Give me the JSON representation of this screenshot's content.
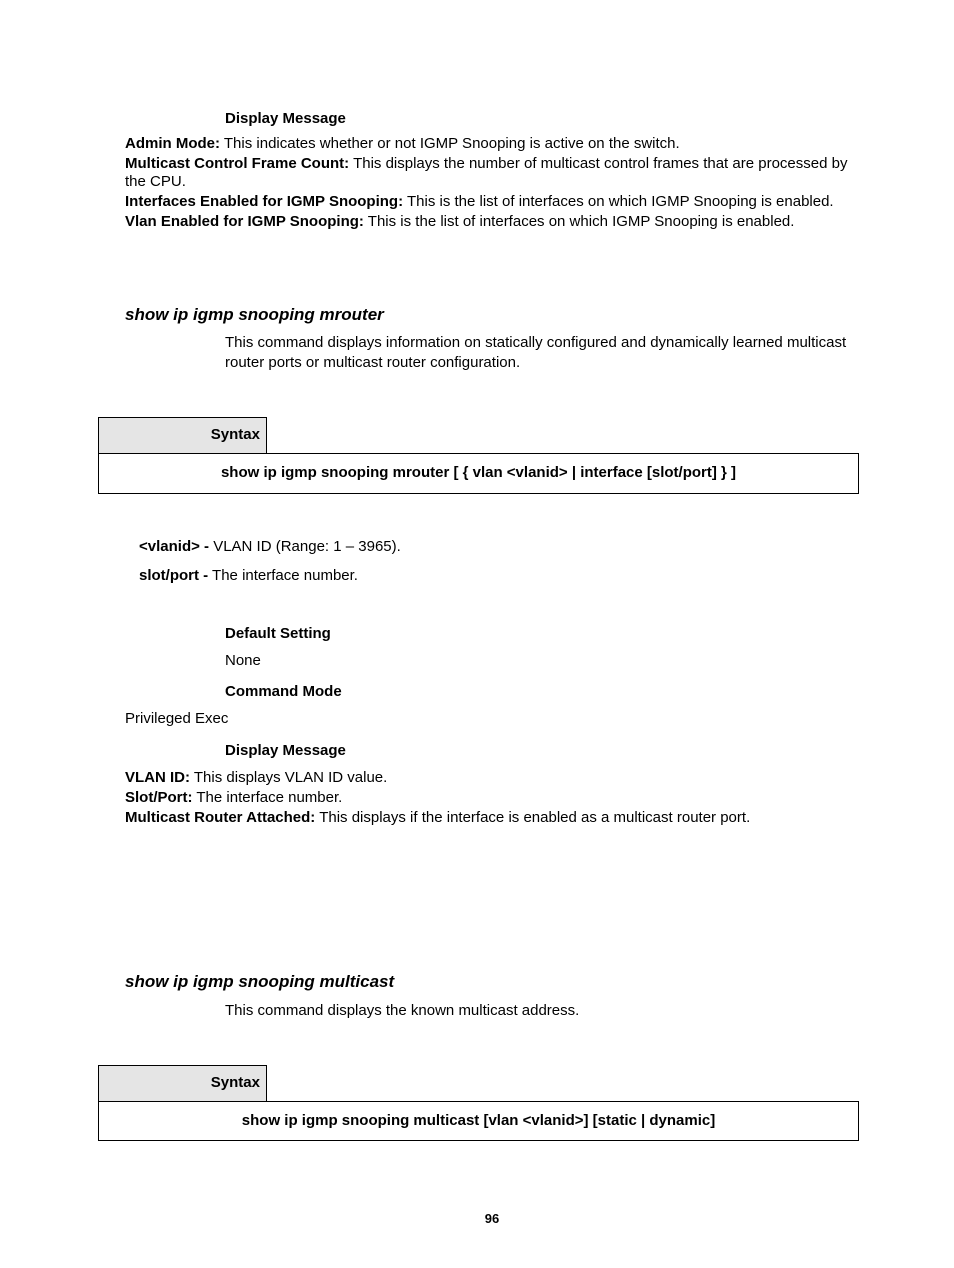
{
  "top": {
    "display_message_label": "Display Message",
    "admin_mode_bold": "Admin Mode:",
    "admin_mode_text": " This indicates whether or not IGMP Snooping is active on the switch.",
    "mcast_control_bold": "Multicast Control Frame Count:",
    "mcast_control_text": " This displays the number of multicast control frames that are processed by the CPU.",
    "interfaces_bold": "Interfaces Enabled for IGMP Snooping:",
    "interfaces_text": " This is the list of interfaces on which IGMP Snooping is enabled.",
    "vlan_enabled_bold": "Vlan Enabled for IGMP Snooping:",
    "vlan_enabled_text": " This is the list of interfaces on which IGMP Snooping is enabled."
  },
  "section1": {
    "heading": "show ip igmp snooping mrouter",
    "desc": "This command displays information on statically configured and dynamically learned multicast router ports or multicast router configuration.",
    "syntax_label": "Syntax",
    "syntax_command": "show ip igmp snooping mrouter [ { vlan <vlanid> | interface [slot/port] } ]",
    "vlanid_bold": "<vlanid> -",
    "vlanid_text": " VLAN ID (Range: 1 – 3965).",
    "slotport_bold": "slot/port -",
    "slotport_text": " The interface number.",
    "default_setting_label": "Default Setting",
    "default_setting_value": "None",
    "command_mode_label": "Command Mode",
    "command_mode_value": "Privileged Exec",
    "display_message_label": "Display Message",
    "vlan_id_bold": "VLAN ID:",
    "vlan_id_text": " This displays VLAN ID value.",
    "slot_port_bold": "Slot/Port:",
    "slot_port_text": " The interface number.",
    "mcast_router_bold": "Multicast Router Attached:",
    "mcast_router_text": " This displays if the interface is enabled as a multicast router port."
  },
  "section2": {
    "heading": "show ip igmp snooping multicast",
    "desc": "This command displays the known multicast address.",
    "syntax_label": "Syntax",
    "syntax_command": "show ip igmp snooping multicast [vlan <vlanid>] [static | dynamic]"
  },
  "page_number": "96"
}
